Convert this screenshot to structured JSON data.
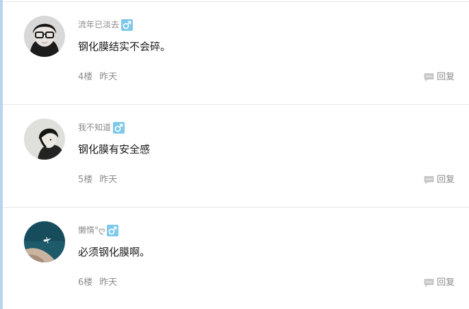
{
  "colors": {
    "divider": "#e6e6e6",
    "username": "#8a8a8a",
    "content": "#1a1a1a",
    "meta": "#8c8c8c",
    "gender_badge": "#7ec8ea",
    "left_accent": "#b9d3ee"
  },
  "comments": [
    {
      "username": "流年已淡去",
      "gender_icon": "male-icon",
      "content": "钢化膜结实不会碎。",
      "floor": "4楼",
      "time": "昨天",
      "reply_label": "回复",
      "reply_icon": "comment-bubble-icon"
    },
    {
      "username": "我不知道",
      "gender_icon": "male-icon",
      "content": "钢化膜有安全感",
      "floor": "5楼",
      "time": "昨天",
      "reply_label": "回复",
      "reply_icon": "comment-bubble-icon"
    },
    {
      "username": "懒惰°ღ",
      "gender_icon": "male-icon",
      "content": "必须钢化膜啊。",
      "floor": "6楼",
      "time": "昨天",
      "reply_label": "回复",
      "reply_icon": "comment-bubble-icon"
    }
  ]
}
